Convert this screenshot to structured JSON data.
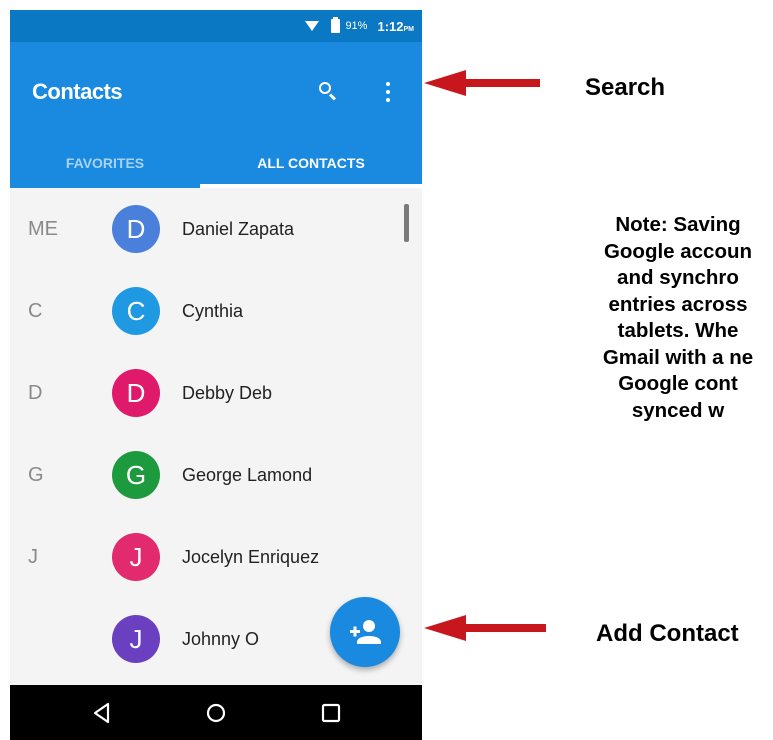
{
  "status_bar": {
    "battery": "91%",
    "time": "1:12",
    "ampm": "PM"
  },
  "app_bar": {
    "title": "Contacts"
  },
  "tabs": [
    {
      "label": "FAVORITES",
      "selected": false
    },
    {
      "label": "ALL CONTACTS",
      "selected": true
    }
  ],
  "contacts": [
    {
      "section": "ME",
      "initial": "D",
      "name": "Daniel Zapata",
      "color": "#4a7fdc"
    },
    {
      "section": "C",
      "initial": "C",
      "name": "Cynthia",
      "color": "#1f9ae2"
    },
    {
      "section": "D",
      "initial": "D",
      "name": "Debby Deb",
      "color": "#e01a6a"
    },
    {
      "section": "G",
      "initial": "G",
      "name": "George Lamond",
      "color": "#1e9a3e"
    },
    {
      "section": "J",
      "initial": "J",
      "name": "Jocelyn Enriquez",
      "color": "#e22a6e"
    },
    {
      "section": "",
      "initial": "J",
      "name": "Johnny O",
      "color": "#6a40c0"
    }
  ],
  "nav_buttons": [
    "back-icon",
    "home-icon",
    "recents-icon"
  ],
  "annotations": {
    "search_label": "Search",
    "add_contact_label": "Add Contact",
    "note_lines": [
      "Note: Saving",
      "Google accoun",
      "and synchro",
      "entries across",
      "tablets. Whe",
      "Gmail with a ne",
      "Google cont",
      "synced w"
    ]
  },
  "colors": {
    "status_bar": "#0a78c2",
    "app_bar": "#1a8ae0",
    "fab": "#1a8ae0",
    "arrow": "#c8161d",
    "nav_bar": "#000000"
  }
}
